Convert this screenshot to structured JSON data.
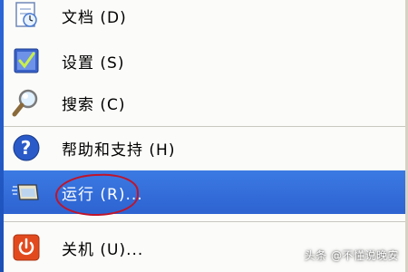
{
  "menu": {
    "items": [
      {
        "label": "文档 (D)",
        "icon": "documents-icon"
      },
      {
        "label": "设置 (S)",
        "icon": "settings-icon"
      },
      {
        "label": "搜索 (C)",
        "icon": "search-icon"
      },
      {
        "label": "帮助和支持 (H)",
        "icon": "help-icon"
      },
      {
        "label": "运行 (R)...",
        "icon": "run-icon"
      },
      {
        "label": "关机 (U)...",
        "icon": "shutdown-icon"
      }
    ]
  },
  "highlight_color": "#316ac5",
  "annotation_color": "#c0142a",
  "watermark": "头条 @不懂说晚安"
}
